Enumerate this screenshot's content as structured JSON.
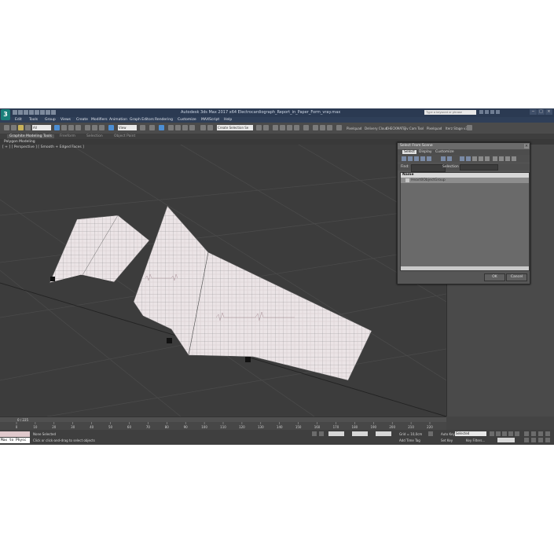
{
  "app": {
    "logo": "3",
    "title": "Autodesk 3ds Max 2017 x64     Electrocardiograph_Report_in_Paper_Form_vray.max",
    "search_placeholder": "Type a keyword or phrase"
  },
  "menu": [
    "Edit",
    "Tools",
    "Group",
    "Views",
    "Create",
    "Modifiers",
    "Animation",
    "Graph Editors",
    "Rendering",
    "Customize",
    "MAXScript",
    "Help"
  ],
  "toolbar": {
    "filter_value": "All",
    "ref_coord_value": "View",
    "selection_set_value": "Create Selection Se",
    "right_labels": [
      "Pixelquad",
      "Delivery Cloud",
      "CHECKMATE",
      "Jiv Cam Tool",
      "Pixelquad",
      "Iterz Stage v3"
    ]
  },
  "ribbon": {
    "tabs": [
      "Graphite Modeling Tools",
      "Freeform",
      "Selection",
      "Object Paint"
    ],
    "sub": "Polygon Modeling"
  },
  "viewport": {
    "label": "[ + ] [ Perspective ] [ Smooth + Edged Faces ]"
  },
  "timeline": {
    "frame": "0 / 225",
    "ticks": [
      "0",
      "10",
      "20",
      "30",
      "40",
      "50",
      "60",
      "70",
      "80",
      "90",
      "100",
      "110",
      "120",
      "130",
      "140",
      "150",
      "160",
      "170",
      "180",
      "190",
      "200",
      "210",
      "220"
    ]
  },
  "status": {
    "maxscript_line": "Max to Physc",
    "selected": "None Selected",
    "prompt": "Click or click-and-drag to select objects",
    "grid": "Grid = 10,0cm",
    "add_time_tag": "Add Time Tag",
    "auto_key": "Auto Key",
    "auto_key_value": "Selected",
    "set_key": "Set Key",
    "key_filters": "Key Filters..."
  },
  "dialog": {
    "title": "Select From Scene",
    "menu": [
      "Select",
      "Display",
      "Customize"
    ],
    "find_label": "Find:",
    "selection_set_label": "Selection Set:",
    "column_header": "Name",
    "items": [
      "Heart0ObjectGroup"
    ],
    "ok": "OK",
    "cancel": "Cancel"
  }
}
